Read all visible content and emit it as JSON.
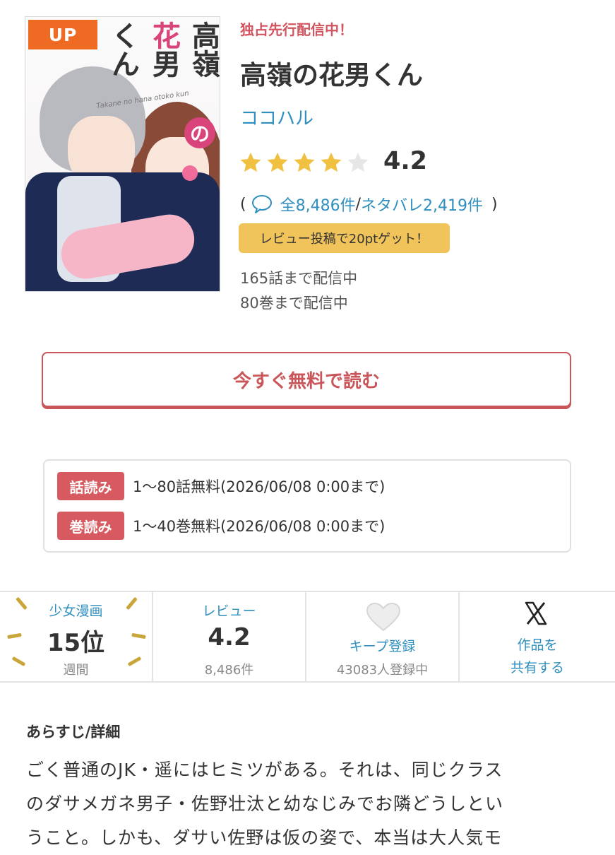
{
  "cover": {
    "badge": "UP",
    "title_col1": "高嶺",
    "title_col2a": "花",
    "title_col2b": "男",
    "title_col3": "くん",
    "title_no": "の",
    "romaji": "Takane no hana otoko kun"
  },
  "header": {
    "exclusive": "独占先行配信中！",
    "title": "高嶺の花男くん",
    "author": "ココハル",
    "rating": "4.2",
    "rating_value": 4.2,
    "review_paren_open": "(",
    "review_all": "全8,486件",
    "review_sep": "/",
    "review_spoiler": "ネタバレ2,419件",
    "review_paren_close": ")",
    "review_bonus": "レビュー投稿で20ptゲット！",
    "episodes_status": "165話まで配信中",
    "volumes_status": "80巻まで配信中"
  },
  "read_button": {
    "label": "今すぐ無料で読む"
  },
  "free": [
    {
      "tag": "話読み",
      "text": "1〜80話無料(2026/06/08 0:00まで)"
    },
    {
      "tag": "巻読み",
      "text": "1〜40巻無料(2026/06/08 0:00まで)"
    }
  ],
  "stats": {
    "ranking": {
      "label": "少女漫画",
      "value": "15位",
      "sub": "週間"
    },
    "review": {
      "label": "レビュー",
      "value": "4.2",
      "sub": "8,486件"
    },
    "keep": {
      "label": "キープ登録",
      "sub": "43083人登録中",
      "icon": "heart-icon"
    },
    "share": {
      "label_line1": "作品を",
      "label_line2": "共有する",
      "icon": "x-logo-icon"
    }
  },
  "synopsis": {
    "heading": "あらすじ/詳細",
    "lines": [
      "ごく普通のJK・遥にはヒミツがある。それは、同じクラス",
      "のダサメガネ男子・佐野壮汰と幼なじみでお隣どうしとい",
      "うこと。しかも、ダサい佐野は仮の姿で、本当は大人気モ"
    ]
  },
  "colors": {
    "accent_red": "#c9565a",
    "link_blue": "#2f8fbf",
    "star_gold": "#f0c040",
    "bonus_yellow": "#f0c45a",
    "badge_orange": "#ef6a22"
  }
}
